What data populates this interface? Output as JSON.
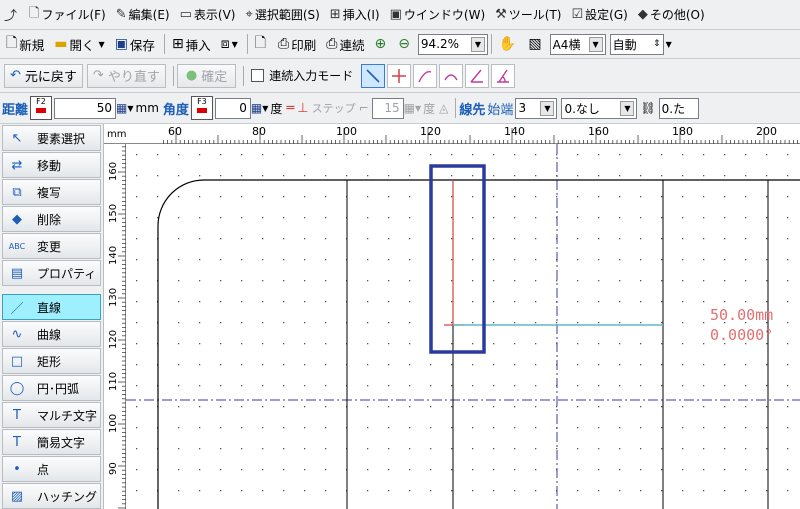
{
  "menu": [
    {
      "icon": "⤴",
      "label": ""
    },
    {
      "icon": "🗋",
      "label": "ファイル(F)"
    },
    {
      "icon": "✎",
      "label": "編集(E)"
    },
    {
      "icon": "▭",
      "label": "表示(V)"
    },
    {
      "icon": "⌖",
      "label": "選択範囲(S)"
    },
    {
      "icon": "⊞",
      "label": "挿入(I)"
    },
    {
      "icon": "▣",
      "label": "ウインドウ(W)"
    },
    {
      "icon": "⚒",
      "label": "ツール(T)"
    },
    {
      "icon": "☑",
      "label": "設定(G)"
    },
    {
      "icon": "◆",
      "label": "その他(O)"
    }
  ],
  "toolbar1": {
    "new_label": "新規",
    "open_label": "開く",
    "save_label": "保存",
    "insert_label": "挿入",
    "print_label": "印刷",
    "continuous_label": "連続",
    "zoom_value": "94.2%",
    "paper_value": "A4横",
    "auto_value": "自動"
  },
  "toolbar2": {
    "undo_label": "元に戻す",
    "redo_label": "やり直す",
    "confirm_label": "確定",
    "continuous_input_label": "連続入力モード"
  },
  "toolbar3": {
    "distance_label": "距離",
    "distance_fkey": "F2",
    "distance_value": "50",
    "distance_unit": "mm",
    "angle_label": "角度",
    "angle_fkey": "F3",
    "angle_value": "0",
    "angle_unit": "度",
    "step_label": "ステップ",
    "step_value": "15",
    "step_unit": "度",
    "line_end_label": "線先",
    "start_label": "始端",
    "start_value": "3",
    "none_value": "0.なし",
    "last_value": "0.た"
  },
  "sidebar": [
    {
      "icon": "↖",
      "label": "要素選択"
    },
    {
      "icon": "⇄",
      "label": "移動"
    },
    {
      "icon": "⧉",
      "label": "複写"
    },
    {
      "icon": "◆",
      "label": "削除"
    },
    {
      "icon": "ABC",
      "label": "変更"
    },
    {
      "icon": "▤",
      "label": "プロパティ"
    },
    {
      "icon": "／",
      "label": "直線",
      "active": true
    },
    {
      "icon": "∿",
      "label": "曲線"
    },
    {
      "icon": "□",
      "label": "矩形"
    },
    {
      "icon": "◯",
      "label": "円･円弧"
    },
    {
      "icon": "T",
      "label": "マルチ文字"
    },
    {
      "icon": "T",
      "label": "簡易文字"
    },
    {
      "icon": "•",
      "label": "点"
    },
    {
      "icon": "▨",
      "label": "ハッチング"
    }
  ],
  "ruler": {
    "unit": "mm",
    "top_ticks": [
      "60",
      "80",
      "100",
      "120",
      "140",
      "160",
      "180",
      "200"
    ],
    "left_ticks": [
      "160",
      "150",
      "140",
      "130",
      "120",
      "110",
      "100",
      "90"
    ]
  },
  "canvas": {
    "length_readout": "50.00mm",
    "angle_readout": "0.0000°"
  },
  "colors": {
    "accent_blue": "#1c5fb8",
    "highlight_box": "#2b3a9e",
    "red_line": "#d94040",
    "cyan_line": "#5fb8c8",
    "readout_red": "#e07070"
  }
}
